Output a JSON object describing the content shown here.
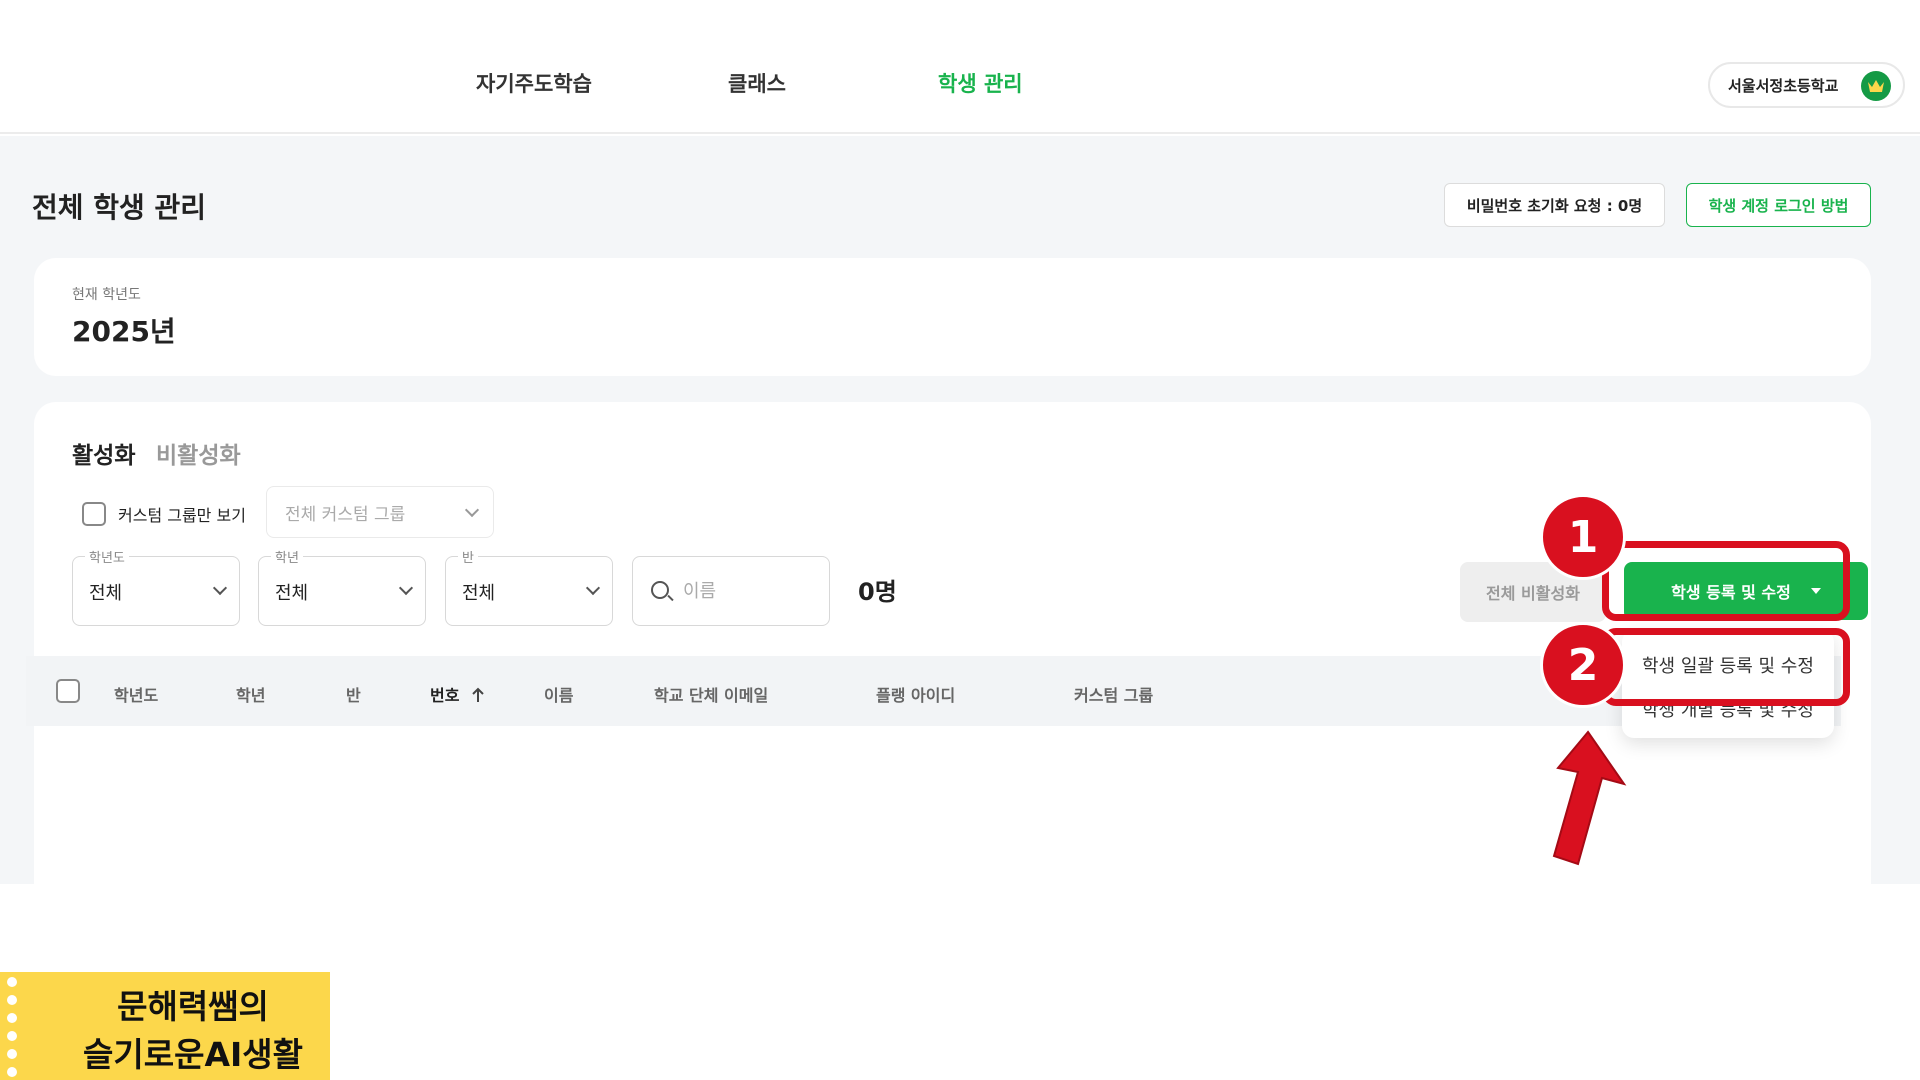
{
  "nav": {
    "items": [
      "자기주도학습",
      "클래스",
      "학생 관리"
    ],
    "active_index": 2,
    "school": "서울서정초등학교"
  },
  "page": {
    "title": "전체 학생 관리",
    "reset_requests_label": "비밀번호 초기화 요청 : 0명",
    "login_howto_label": "학생 계정 로그인 방법"
  },
  "year_card": {
    "label": "현재 학년도",
    "value": "2025년"
  },
  "tabs": {
    "active": "활성화",
    "inactive": "비활성화"
  },
  "filters": {
    "custom_only_label": "커스텀 그룹만 보기",
    "custom_group_placeholder": "전체 커스텀 그룹",
    "school_year": {
      "legend": "학년도",
      "value": "전체"
    },
    "grade": {
      "legend": "학년",
      "value": "전체"
    },
    "class": {
      "legend": "반",
      "value": "전체"
    },
    "search_placeholder": "이름",
    "count": "0명"
  },
  "actions": {
    "deactivate_all": "전체 비활성화",
    "register_edit": "학생 등록 및 수정"
  },
  "table": {
    "headers": [
      "학년도",
      "학년",
      "반",
      "번호",
      "이름",
      "학교 단체 이메일",
      "플랭 아이디",
      "커스텀 그룹"
    ]
  },
  "dropdown": {
    "items": [
      "학생 일괄 등록 및 수정",
      "학생 개별 등록 및 수정"
    ]
  },
  "annotations": {
    "badge_1": "1",
    "badge_2": "2",
    "color": "#d9101f"
  },
  "logo": {
    "line1": "문해력쌤의",
    "line2": "슬기로운AI생활"
  },
  "colors": {
    "accent": "#19b34d",
    "annotation": "#d9101f",
    "logo_bg": "#fcd74b"
  }
}
